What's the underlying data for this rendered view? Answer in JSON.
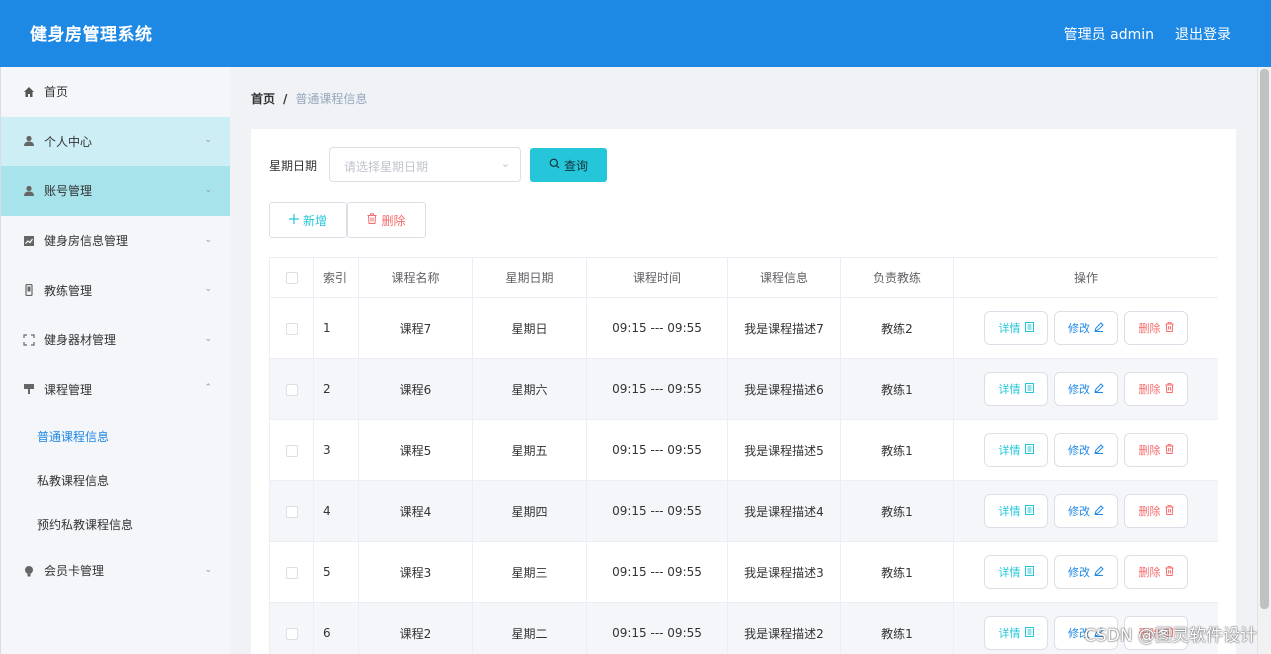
{
  "header": {
    "title": "健身房管理系统",
    "user": "管理员 admin",
    "logout": "退出登录"
  },
  "sidebar": {
    "items": [
      {
        "label": "首页",
        "icon": "home-icon"
      },
      {
        "label": "个人中心",
        "icon": "user-icon",
        "expandable": true
      },
      {
        "label": "账号管理",
        "icon": "user-icon",
        "expandable": true
      },
      {
        "label": "健身房信息管理",
        "icon": "chart-icon",
        "expandable": true
      },
      {
        "label": "教练管理",
        "icon": "phone-icon",
        "expandable": true
      },
      {
        "label": "健身器材管理",
        "icon": "fullscreen-icon",
        "expandable": true
      },
      {
        "label": "课程管理",
        "icon": "sign-icon",
        "expandable": true,
        "expanded": true
      }
    ],
    "sub_items": [
      {
        "label": "普通课程信息",
        "active": true
      },
      {
        "label": "私教课程信息"
      },
      {
        "label": "预约私教课程信息"
      }
    ],
    "last_item": {
      "label": "会员卡管理",
      "icon": "bulb-icon"
    }
  },
  "breadcrumb": {
    "home": "首页",
    "separator": "/",
    "current": "普通课程信息"
  },
  "filter": {
    "label": "星期日期",
    "placeholder": "请选择星期日期",
    "search_button": "查询"
  },
  "actions": {
    "add": "新增",
    "delete": "删除"
  },
  "table": {
    "columns": [
      "索引",
      "课程名称",
      "星期日期",
      "课程时间",
      "课程信息",
      "负责教练",
      "操作"
    ],
    "op_labels": {
      "detail": "详情",
      "edit": "修改",
      "remove": "删除"
    },
    "rows": [
      {
        "index": "1",
        "name": "课程7",
        "day": "星期日",
        "time": "09:15 --- 09:55",
        "info": "我是课程描述7",
        "coach": "教练2"
      },
      {
        "index": "2",
        "name": "课程6",
        "day": "星期六",
        "time": "09:15 --- 09:55",
        "info": "我是课程描述6",
        "coach": "教练1"
      },
      {
        "index": "3",
        "name": "课程5",
        "day": "星期五",
        "time": "09:15 --- 09:55",
        "info": "我是课程描述5",
        "coach": "教练1"
      },
      {
        "index": "4",
        "name": "课程4",
        "day": "星期四",
        "time": "09:15 --- 09:55",
        "info": "我是课程描述4",
        "coach": "教练1"
      },
      {
        "index": "5",
        "name": "课程3",
        "day": "星期三",
        "time": "09:15 --- 09:55",
        "info": "我是课程描述3",
        "coach": "教练1"
      },
      {
        "index": "6",
        "name": "课程2",
        "day": "星期二",
        "time": "09:15 --- 09:55",
        "info": "我是课程描述2",
        "coach": "教练1"
      }
    ]
  },
  "watermark": "CSDN @图灵软件设计",
  "colors": {
    "header": "#1e88e5",
    "accent": "#26c6da",
    "danger": "#f56c6c",
    "active_link": "#1e88e5"
  }
}
